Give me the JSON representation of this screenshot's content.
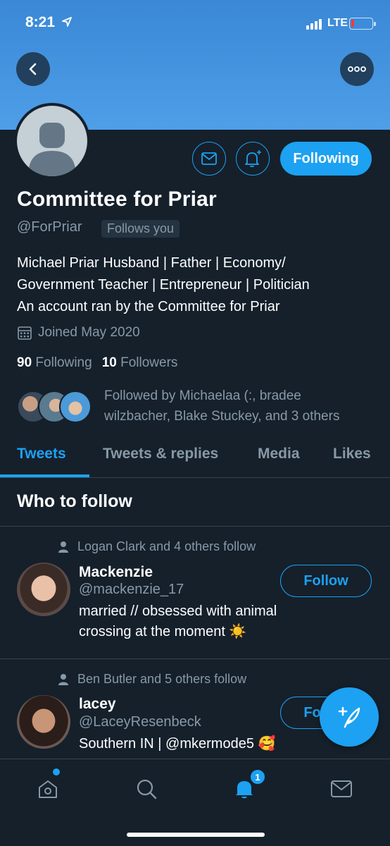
{
  "status_bar": {
    "time": "8:21",
    "network": "LTE"
  },
  "profile": {
    "name": "Committee for Priar",
    "handle": "@ForPriar",
    "follows_you": "Follows you",
    "following_label": "Following",
    "bio_lines": [
      "Michael Priar Husband | Father | Economy/",
      "Government Teacher | Entrepreneur | Politician",
      "An account ran by the Committee for Priar"
    ],
    "joined": "Joined May 2020",
    "following_count": "90",
    "following_label_text": "Following",
    "followers_count": "10",
    "followers_label_text": "Followers",
    "followed_by_lines": [
      "Followed by Michaelaa (:, bradee",
      "wilzbacher, Blake Stuckey, and 3 others"
    ]
  },
  "tabs": [
    "Tweets",
    "Tweets & replies",
    "Media",
    "Likes"
  ],
  "who_to_follow": {
    "title": "Who to follow",
    "users": [
      {
        "context": "Logan Clark and 4 others follow",
        "name": "Mackenzie",
        "handle": "@mackenzie_17",
        "bio_lines": [
          "married // obsessed with animal",
          "crossing at the moment ☀️"
        ],
        "button": "Follow"
      },
      {
        "context": "Ben Butler and 5 others follow",
        "name": "lacey",
        "handle": "@LaceyResenbeck",
        "bio_lines": [
          "Southern IN | @mkermode5 🥰"
        ],
        "button": "Follow"
      }
    ]
  },
  "bottom_nav": {
    "notification_count": "1"
  },
  "colors": {
    "background": "#15202b",
    "accent": "#1da1f2",
    "muted": "#8899a6",
    "banner": "#4e9ee8"
  }
}
